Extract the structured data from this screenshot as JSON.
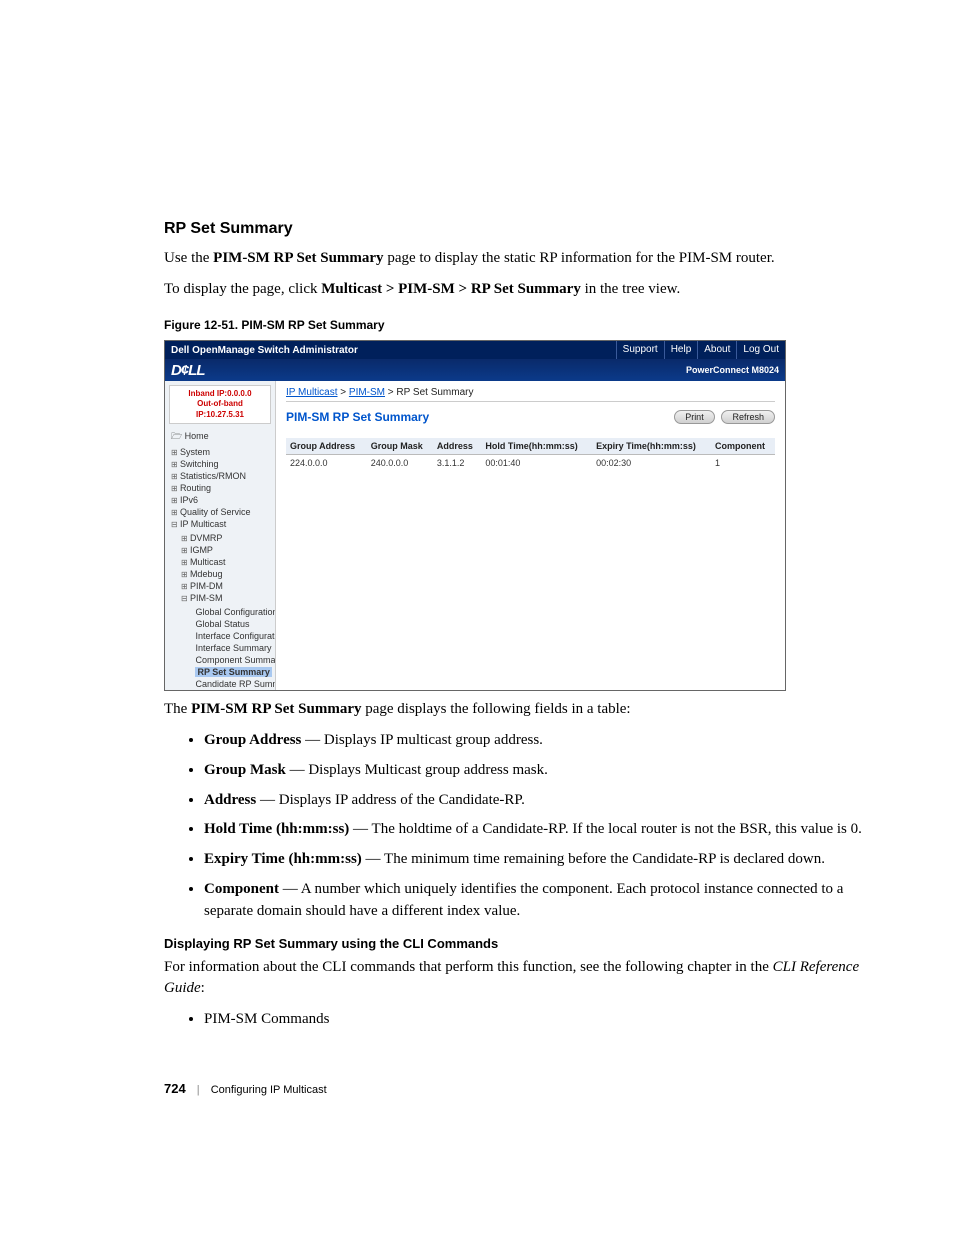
{
  "doc": {
    "section_title": "RP Set Summary",
    "intro_pre": "Use the ",
    "intro_bold": "PIM-SM RP Set Summary",
    "intro_post": " page to display the static RP information for the PIM-SM router.",
    "nav_pre": "To display the page, click ",
    "nav_bold": "Multicast > PIM-SM > RP Set Summary",
    "nav_post": " in the tree view.",
    "fig_caption": "Figure 12-51.    PIM-SM RP Set Summary",
    "after_shot_pre": "The ",
    "after_shot_bold": "PIM-SM RP Set Summary",
    "after_shot_post": " page displays the following fields in a table:",
    "fields": [
      {
        "term": "Group Address",
        "desc": " — Displays IP multicast group address."
      },
      {
        "term": "Group Mask",
        "desc": " — Displays Multicast group address mask."
      },
      {
        "term": "Address",
        "desc": " — Displays IP address of the Candidate-RP."
      },
      {
        "term": "Hold Time (hh:mm:ss)",
        "desc": " — The holdtime of a Candidate-RP. If the local router is not the BSR, this value is 0."
      },
      {
        "term": "Expiry Time (hh:mm:ss)",
        "desc": " — The minimum time remaining before the Candidate-RP is declared down."
      },
      {
        "term": "Component",
        "desc": " — A number which uniquely identifies the component. Each protocol instance connected to a separate domain should have a different index value."
      }
    ],
    "cli_heading": "Displaying RP Set Summary using the CLI Commands",
    "cli_para_pre": "For information about the CLI commands that perform this function, see the following chapter in the ",
    "cli_para_ital": "CLI Reference Guide",
    "cli_para_post": ":",
    "cli_bullet": "PIM-SM Commands",
    "page_number": "724",
    "footer_chapter": "Configuring IP Multicast"
  },
  "shot": {
    "title": "Dell OpenManage Switch Administrator",
    "nav": [
      "Support",
      "Help",
      "About",
      "Log Out"
    ],
    "logo": "D¢LL",
    "model": "PowerConnect M8024",
    "inband": "Inband IP:0.0.0.0",
    "oob": "Out-of-band IP:10.27.5.31",
    "tree": {
      "home": "Home",
      "items": [
        "System",
        "Switching",
        "Statistics/RMON",
        "Routing",
        "IPv6",
        "Quality of Service"
      ],
      "ipmc": "IP Multicast",
      "ipmc_children": [
        "DVMRP",
        "IGMP",
        "Multicast",
        "Mdebug",
        "PIM-DM"
      ],
      "pimsm": "PIM-SM",
      "pimsm_children": [
        "Global Configuration",
        "Global Status",
        "Interface Configuration",
        "Interface Summary",
        "Component Summary",
        "RP Set Summary",
        "Candidate RP Summ"
      ]
    },
    "breadcrumb": {
      "a": "IP Multicast",
      "b": "PIM-SM",
      "c": "RP Set Summary"
    },
    "page_title": "PIM-SM RP Set Summary",
    "btn_print": "Print",
    "btn_refresh": "Refresh",
    "table": {
      "headers": [
        "Group Address",
        "Group Mask",
        "Address",
        "Hold Time(hh:mm:ss)",
        "Expiry Time(hh:mm:ss)",
        "Component"
      ],
      "row": [
        "224.0.0.0",
        "240.0.0.0",
        "3.1.1.2",
        "00:01:40",
        "00:02:30",
        "1"
      ]
    }
  }
}
